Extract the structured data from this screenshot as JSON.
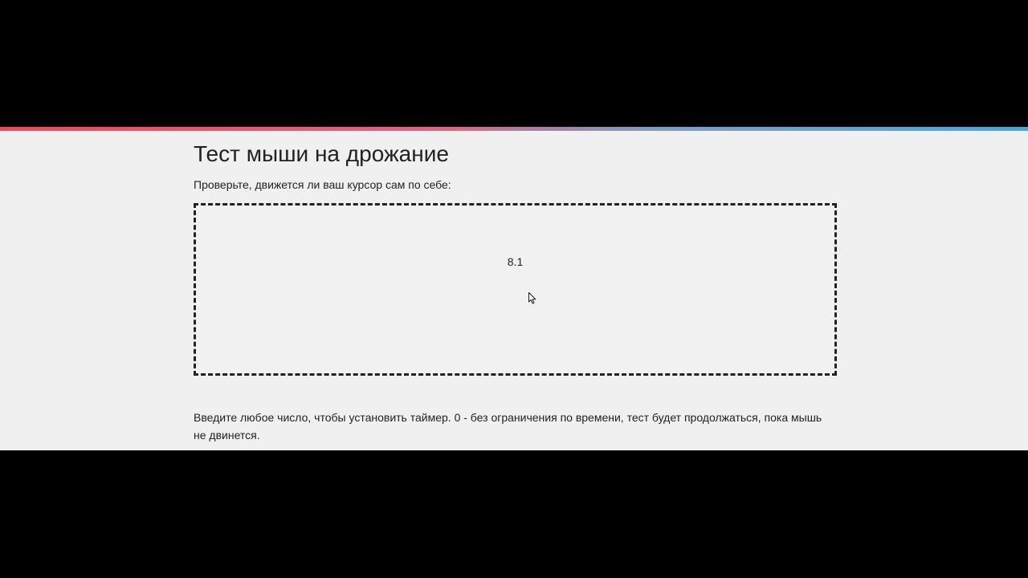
{
  "page": {
    "title": "Тест мыши на дрожание",
    "subtitle": "Проверьте, движется ли ваш курсор сам по себе:",
    "instructions": "Введите любое число, чтобы установить таймер. 0 - без ограничения по времени, тест будет продолжаться, пока мышь не двинется."
  },
  "test_area": {
    "counter_value": "8.1",
    "cursor": "arrow-cursor-icon"
  },
  "colors": {
    "background": "#f0f0f0",
    "text": "#222222",
    "border": "#222222",
    "gradient_left": "#e0505a",
    "gradient_right": "#5aa0d0",
    "letterbox": "#000000"
  }
}
